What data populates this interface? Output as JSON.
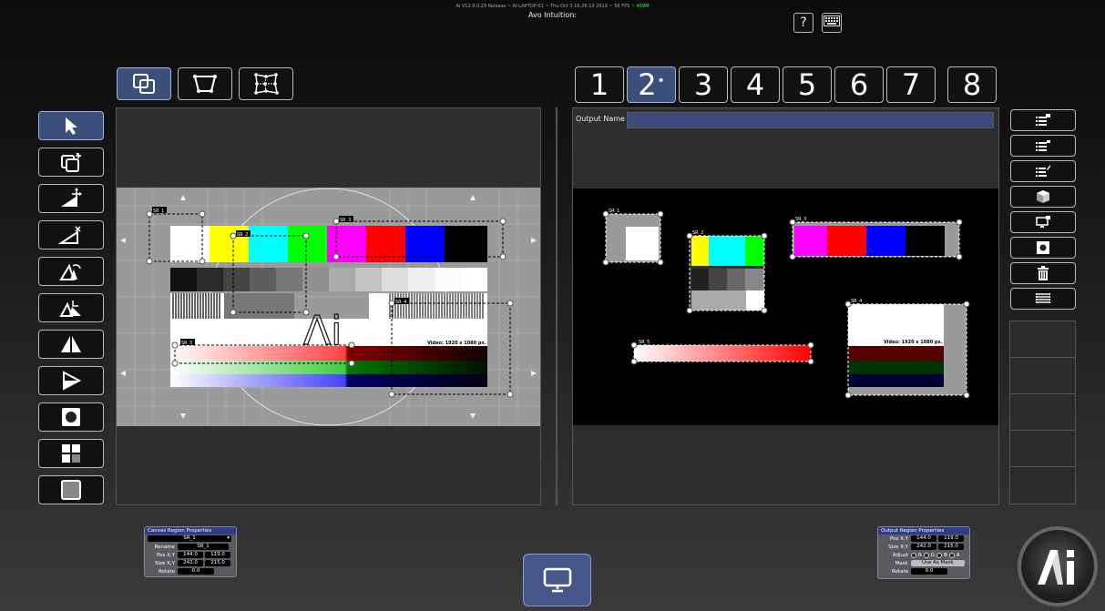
{
  "status": {
    "version_line": "Ai V12.0.0.29 Release ~ AI-LAPTOP-01 ~ Thu Oct  3 16:26:13 2019 ~ 58 FPS",
    "fps_extra": "~ 469M",
    "title": "Avo Intuition:"
  },
  "top_buttons": {
    "help": "?"
  },
  "output_tabs": [
    "1",
    "2",
    "3",
    "4",
    "5",
    "6",
    "7",
    "8"
  ],
  "active_output_tab": "2",
  "output": {
    "name_label": "Output Name",
    "name_value": ""
  },
  "canvas": {
    "regions": [
      "SR_1",
      "SR_2",
      "SR_3",
      "SR_4",
      "SR_5"
    ],
    "video_label": "Video: 1920 x 1080 px."
  },
  "canvas_props": {
    "title": "Canvas Region Properties",
    "selected": "SR_1",
    "rename_label": "Rename",
    "rename_value": "SR_1",
    "pos_label": "Pos X,Y",
    "pos_x": "144.0",
    "pos_y": "119.0",
    "size_label": "Size X,Y",
    "size_x": "242.0",
    "size_y": "215.0",
    "rotate_label": "Rotate",
    "rotate_value": "0.0"
  },
  "output_props": {
    "title": "Output Region Properties",
    "pos_label": "Pos X,Y",
    "pos_x": "144.0",
    "pos_y": "119.0",
    "size_label": "Size X,Y",
    "size_x": "242.0",
    "size_y": "215.0",
    "adjust_label": "Adjust",
    "adjust_r": "R",
    "adjust_g": "G",
    "adjust_b": "B",
    "adjust_a": "A",
    "mask_label": "Mask",
    "mask_button": "Use As Mask",
    "rotate_label": "Rotate",
    "rotate_value": "0.0"
  },
  "colors": {
    "accent": "#3b4f7a",
    "props_header": "#2d3b8a"
  }
}
